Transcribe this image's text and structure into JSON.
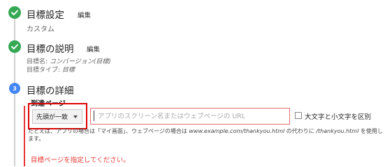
{
  "steps": [
    {
      "title": "目標設定",
      "edit_label": "編集",
      "summary": "カスタム",
      "status": "complete",
      "icon": "check-icon"
    },
    {
      "title": "目標の説明",
      "edit_label": "編集",
      "name_label": "目標名:",
      "name_value": "コンバージョン(目標)",
      "type_label": "目標タイプ:",
      "type_value": "目標",
      "status": "complete",
      "icon": "check-icon"
    },
    {
      "number": "3",
      "title": "目標の詳細",
      "status": "active",
      "destination": {
        "label": "到達ページ",
        "match_type": "先頭が一致",
        "url_placeholder": "アプリのスクリーン名またはウェブページの URL",
        "url_value": "",
        "case_sensitive_label": "大文字と小文字を区別",
        "case_sensitive_checked": false,
        "hint_prefix": "たとえば、アプリの場合は「",
        "hint_app_example": "マイ画面",
        "hint_middle": "」、ウェブページの場合は ",
        "hint_web_example": "www.example.com/thankyou.html",
        "hint_middle2": " の代わりに ",
        "hint_path_example": "/thankyou.html",
        "hint_suffix": " を使用します。",
        "error_message": "目標ページを指定してください。"
      }
    }
  ],
  "colors": {
    "complete": "#34a853",
    "active": "#4285f4",
    "error": "#e53935",
    "highlight": "#e00000"
  }
}
